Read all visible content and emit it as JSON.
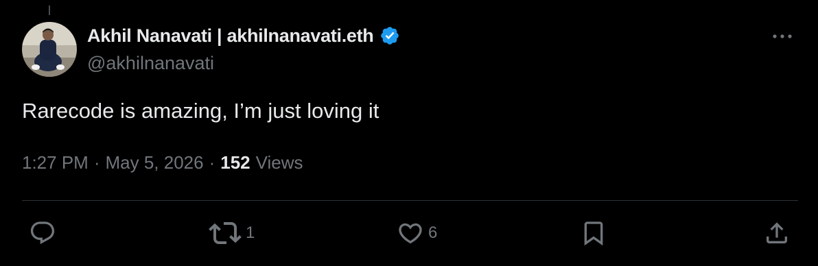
{
  "tweet": {
    "author": {
      "display_name": "Akhil Nanavati | akhilnanavati.eth",
      "handle": "@akhilnanavati",
      "verified": true,
      "verified_color": "#1d9bf0"
    },
    "text": "Rarecode is amazing, I’m just loving it",
    "meta": {
      "time": "1:27 PM",
      "separator": "·",
      "date": "May 5, 2026",
      "views_count": "152",
      "views_label": "Views"
    },
    "actions": {
      "reply_count": "",
      "retweet_count": "1",
      "like_count": "6"
    },
    "icons": {
      "avatar": "avatar",
      "verified": "verified-badge-icon",
      "more": "more-options-icon",
      "reply": "reply-icon",
      "retweet": "retweet-icon",
      "like": "heart-icon",
      "bookmark": "bookmark-icon",
      "share": "share-icon"
    }
  },
  "colors": {
    "background": "#000000",
    "primary_text": "#e7e9ea",
    "secondary_text": "#71767b",
    "divider": "#2f3336"
  }
}
